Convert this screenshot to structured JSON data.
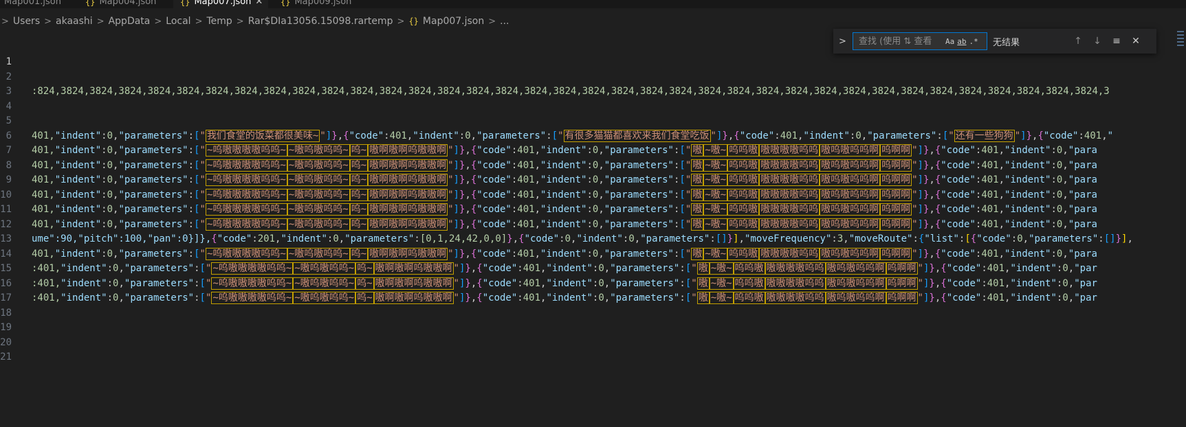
{
  "tabs": [
    {
      "name": "tab-map001",
      "icon": "{}",
      "label": "Map001.json",
      "active": false
    },
    {
      "name": "tab-map004",
      "icon": "{}",
      "label": "Map004.json",
      "active": false
    },
    {
      "name": "tab-map007",
      "icon": "{}",
      "label": "Map007.json",
      "active": true,
      "close": "✕"
    },
    {
      "name": "tab-map009",
      "icon": "{}",
      "label": "Map009.json",
      "active": false
    }
  ],
  "breadcrumb": {
    "items": [
      "Users",
      "akaashi",
      "AppData",
      "Local",
      "Temp",
      "Rar$DIa13056.15098.rartemp"
    ],
    "file_icon": "{}",
    "file": "Map007.json",
    "trailing": "..."
  },
  "find": {
    "toggle_icon": "chevron-right-icon",
    "placeholder": "查找 (使用 ⇅ 查看",
    "match_case": "Aa",
    "whole_word": "ab",
    "regex": ".*",
    "result": "无结果",
    "prev": "↑",
    "next": "↓",
    "menu": "≡",
    "close": "✕"
  },
  "line_numbers": [
    "1",
    "2",
    "3",
    "4",
    "5",
    "6",
    "7",
    "8",
    "9",
    "10",
    "11",
    "12",
    "13",
    "14",
    "15",
    "16",
    "17",
    "18",
    "19",
    "20",
    "21"
  ],
  "code": {
    "line3": ":824,3824,3824,3824,3824,3824,3824,3824,3824,3824,3824,3824,3824,3824,3824,3824,3824,3824,3824,3824,3824,3824,3824,3824,3824,3824,3824,3824,3824,3824,3824,3824,3824,3824,3824,3824,3824,3",
    "line6": {
      "prefix": "401,",
      "t1": "我们食堂的饭菜都很美味~",
      "t2": "有很多猫猫都喜欢来我们食堂吃饭",
      "t3": "还有一些狗狗"
    },
    "moan_a1": "~呜嗷嗷嗷嗷呜呜~",
    "moan_a2": "~嗷呜嗷呜呜~",
    "moan_a3": "呜~",
    "moan_a4": "嗷啊嗷啊呜嗷嗷啊",
    "moan_b1": "嗷",
    "moan_b2": "~嗷~",
    "moan_b3": "呜呜嗷",
    "moan_b4": "嗷嗷嗷嗷呜呜",
    "moan_b5": "嗷呜嗷呜呜啊",
    "moan_b6": "呜啊啊",
    "line13": {
      "prefix": "ume\":90,\"pitch\":100,\"pan\":0}]},",
      "params": "[0,1,24,42,0,0]",
      "moveFrequency": "3"
    },
    "rows_prefix_a": "401,",
    "rows_prefix_b": ":401,"
  }
}
